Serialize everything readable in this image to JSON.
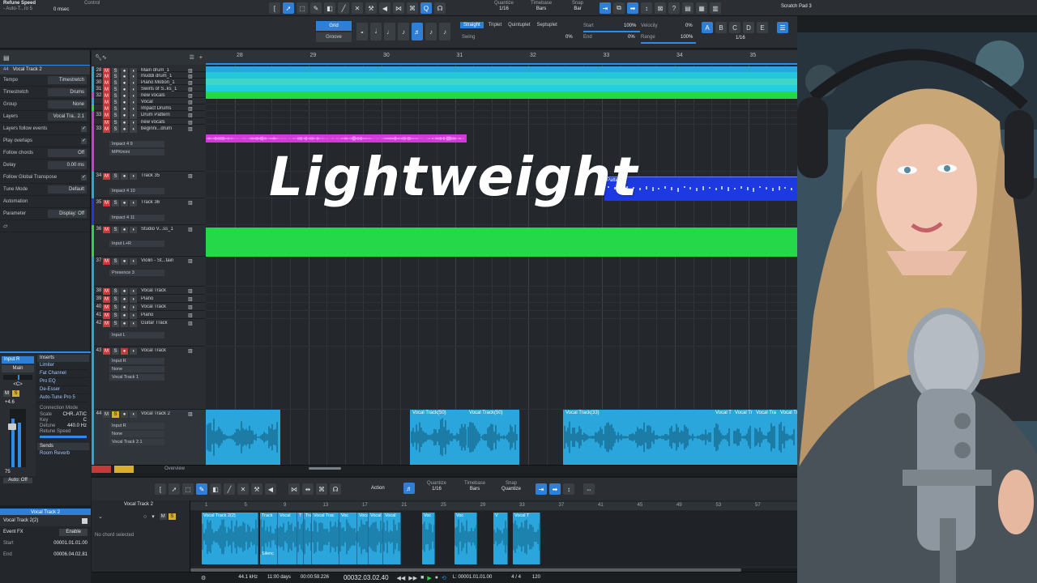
{
  "headline": "Lightweight",
  "colors": {
    "accent": "#2f8be8",
    "cyan": "#2aa6dc",
    "green": "#24d84a",
    "magenta": "#d23ad8",
    "blue": "#1c39e2",
    "mute": "#c23a3a",
    "solo_yellow": "#d8ae2b"
  },
  "topbar": {
    "left_title": "Refune Speed",
    "left_sub": "- Auto-T...ro 5",
    "left_time": "0 msec",
    "control_label": "Control",
    "quantize": {
      "label": "Quantize",
      "value": "1/16"
    },
    "timebase": {
      "label": "Timebase",
      "value": "Bars"
    },
    "snap": {
      "label": "Snap",
      "value": "Bar"
    },
    "scratch": "Scratch Pad 3"
  },
  "toolbar2": {
    "grid": "Grid",
    "groove": "Groove",
    "modes": [
      "Straight",
      "Triplet",
      "Quintuplet",
      "Septuplet"
    ],
    "swing": "Swing",
    "swing_val": "0%",
    "start_label": "Start",
    "start_val": "100%",
    "end_label": "End",
    "end_val": "0%",
    "velocity_label": "Velocity",
    "velocity_val": "0%",
    "range_label": "Range",
    "range_val": "100%",
    "letters": [
      "A",
      "B",
      "C",
      "D",
      "E"
    ],
    "fraction": "1/16"
  },
  "inspector": {
    "track_num": "44",
    "track_name": "Vocal Track 2",
    "rows": [
      {
        "k": "Tempo",
        "v": "Timestretch"
      },
      {
        "k": "Timestretch",
        "v": "Drums"
      },
      {
        "k": "Group",
        "v": "None"
      },
      {
        "k": "Layers",
        "v": "Vocal Tra.. 2.1"
      },
      {
        "k": "Layers follow events",
        "check": true
      },
      {
        "k": "Play overlaps",
        "check": true
      },
      {
        "k": "Follow chords",
        "v": "Off"
      },
      {
        "k": "Delay",
        "v": "0.00 ms"
      },
      {
        "k": "Follow Global Transpose",
        "check": true
      },
      {
        "k": "Tune Mode",
        "v": "Default"
      },
      {
        "k": "Automation",
        "v": ""
      },
      {
        "k": "Parameter",
        "v": "Display: Off"
      }
    ]
  },
  "tracks": [
    {
      "n": "28",
      "name": "Main drum_1"
    },
    {
      "n": "29",
      "name": "muddi drum_1"
    },
    {
      "n": "30",
      "name": "Piano Motion_1"
    },
    {
      "n": "31",
      "name": "Swirls of S..ks_1"
    },
    {
      "n": "32",
      "name": "new vocals"
    },
    {
      "n": "",
      "name": "Vocal"
    },
    {
      "n": "",
      "name": "Impact Drums"
    },
    {
      "n": "33",
      "name": "Drum Pattern"
    },
    {
      "n": "",
      "name": "new vocals"
    },
    {
      "n": "33",
      "name": "beginni...drum"
    },
    {
      "n": "34",
      "name": "Track 35"
    },
    {
      "n": "35",
      "name": "Track 36"
    },
    {
      "n": "36",
      "name": "Studio V...ss_1"
    },
    {
      "n": "37",
      "name": "Violin - St...tain"
    },
    {
      "n": "38",
      "name": "Vocal Track"
    },
    {
      "n": "39",
      "name": "Piano"
    },
    {
      "n": "40",
      "name": "Vocal Track"
    },
    {
      "n": "41",
      "name": "Piano"
    },
    {
      "n": "42",
      "name": "Guitar Track"
    },
    {
      "n": "43",
      "name": "Vocal Track"
    },
    {
      "n": "44",
      "name": "Vocal Track 2"
    }
  ],
  "track_sub": {
    "impact49": "Impact 4 9",
    "mpk": "MPKmini",
    "impact410": "Impact 4 10",
    "impact411": "Impact 4 11",
    "inputLR": "Input L+R",
    "stereo": "Stereo",
    "presence": "Presence 3",
    "inputL": "Input L",
    "mono": "Mono",
    "none": "None",
    "vt1": "Vocal Track 1",
    "inputR": "Input R",
    "vt21": "Vocal Track 2.1"
  },
  "ruler": [
    "28",
    "29",
    "30",
    "31",
    "32",
    "33",
    "34",
    "35"
  ],
  "clips": {
    "pattern": "Pattern",
    "vocal_a": "Vocal Track(50)",
    "vocal_b": "Vocal Track(50)",
    "vocal_c": "Vocal Track(33)",
    "vocal_d": "Vocal T",
    "vocal_e": "Vocal Tr",
    "vocal_f": "Vocal Tra",
    "vocal_g": "Vocal Tr"
  },
  "mixer": {
    "input": "Input R",
    "main": "Main",
    "pan": "<C>",
    "level": "+4.6",
    "fader_val": "75",
    "auto": "Auto: Off",
    "name": "Vocal Track 2",
    "inserts_label": "Inserts",
    "inserts": [
      "Limiter",
      "Fat Channel",
      "Pro EQ",
      "De-Esser",
      "Auto-Tune Pro 5"
    ],
    "conn": "Connection Mode",
    "scale": "Scale",
    "scale_v": "CHR..ATIC",
    "key": "Key",
    "key_v": "C",
    "detune": "Detune",
    "detune_v": "440.0 Hz",
    "retune": "Retune Speed",
    "sends_label": "Sends",
    "sends": [
      "Room Reverb"
    ]
  },
  "bottom_left": {
    "title": "Vocal Track 2(2)",
    "event_fx": "Event FX",
    "enable": "Enable",
    "start": "Start",
    "start_v": "00001.01.01.00",
    "end": "End",
    "end_v": "00006.04.02.81"
  },
  "editor": {
    "action": "Action",
    "quantize": "Quantize",
    "quantize_v": "1/16",
    "timebase": "Timebase",
    "timebase_v": "Bars",
    "snap": "Snap",
    "snap_v": "Quantize",
    "track": "Vocal Track 2",
    "no_chord": "No chord selected",
    "ruler": [
      "1",
      "5",
      "9",
      "13",
      "17",
      "21",
      "25",
      "29",
      "33",
      "37",
      "41",
      "45",
      "49",
      "53",
      "57"
    ],
    "clip_names": [
      "Vocal Track 2(2)",
      "Track",
      "Vocal",
      "T",
      "Tra",
      "Vocal Trac",
      "Voc",
      "Vocal",
      "Vocal",
      "Voc",
      "V",
      "Vocal T"
    ],
    "clip_low": "Silenc"
  },
  "overview": "Overview",
  "status": {
    "rate": "44.1 kHz",
    "days": "11:00 days",
    "time": "00:00:59.226",
    "bars": "00032.03.02.40",
    "loop": "L: 00001.01.01.00",
    "sig": "4 / 4",
    "tempo": "120"
  }
}
